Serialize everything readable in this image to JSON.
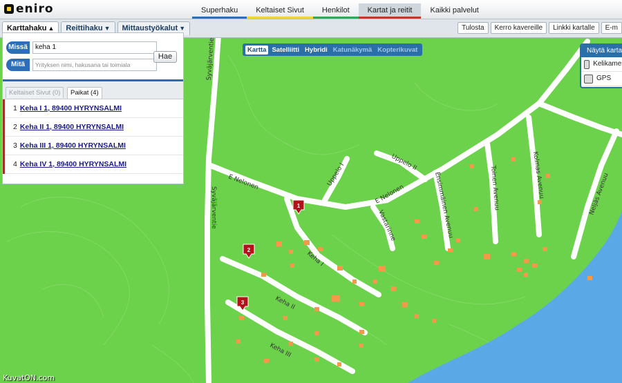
{
  "logo": {
    "text": "eniro"
  },
  "top_nav": [
    {
      "label": "Superhaku",
      "color": "#2f6fb3"
    },
    {
      "label": "Keltaiset Sivut",
      "color": "#f0d43a"
    },
    {
      "label": "Henkilot",
      "color": "#3aa35b"
    },
    {
      "label": "Kartat ja reitit",
      "color": "#c0392b"
    },
    {
      "label": "Kaikki palvelut",
      "color": ""
    }
  ],
  "sub_tabs": [
    {
      "label": "Karttahaku"
    },
    {
      "label": "Reittihaku"
    },
    {
      "label": "Mittaustyökalut"
    }
  ],
  "tool_buttons": [
    "Tulosta",
    "Kerro kavereille",
    "Linkki kartalle",
    "E-m"
  ],
  "search": {
    "where_label": "Missä",
    "where_value": "keha 1",
    "what_label": "Mitä",
    "what_placeholder": "Yrityksen nimi, hakusana tai toimiala",
    "button": "Hae"
  },
  "result_tabs": {
    "yellow_pages": "Keltaiset Sivut (0)",
    "places": "Paikat (4)"
  },
  "results": [
    {
      "num": "1",
      "text": "Keha I 1, 89400 HYRYNSALMI"
    },
    {
      "num": "2",
      "text": "Keha II 1, 89400 HYRYNSALMI"
    },
    {
      "num": "3",
      "text": "Keha III 1, 89400 HYRYNSALMI"
    },
    {
      "num": "4",
      "text": "Keha IV 1, 89400 HYRYNSALMI"
    }
  ],
  "map_types": {
    "map": "Kartta",
    "satellite": "Satelliitti",
    "hybrid": "Hybridi",
    "street": "Katunäkymä",
    "heli": "Kopterikuvat"
  },
  "show_map": {
    "title": "Näytä kartalla",
    "options": [
      "Kelikamerat",
      "GPS"
    ]
  },
  "map_labels": {
    "syvajarventie": "Syväjärventie",
    "e_nelonen": "E Nelonen",
    "uppelo_i": "Uppelo I",
    "uppelo_ii": "Uppelo II",
    "vastarinne": "Vastarinne",
    "ensimmainen": "Ensimmäinen Avenuu",
    "toinen": "Toinen Avenuu",
    "kolmas": "Kolmas Avenuu",
    "neljas": "Neljäs Avenuu",
    "keha_i": "Keha I",
    "keha_ii": "Keha II",
    "keha_iii": "Keha III"
  },
  "markers": [
    "1",
    "2",
    "3"
  ],
  "colors": {
    "land": "#6cd24c",
    "water": "#5aa9e6",
    "building": "#f39a4a",
    "road": "#ffffff",
    "marker": "#b3121a",
    "accent": "#2a6fa8"
  },
  "watermark": "KuvatON.com"
}
